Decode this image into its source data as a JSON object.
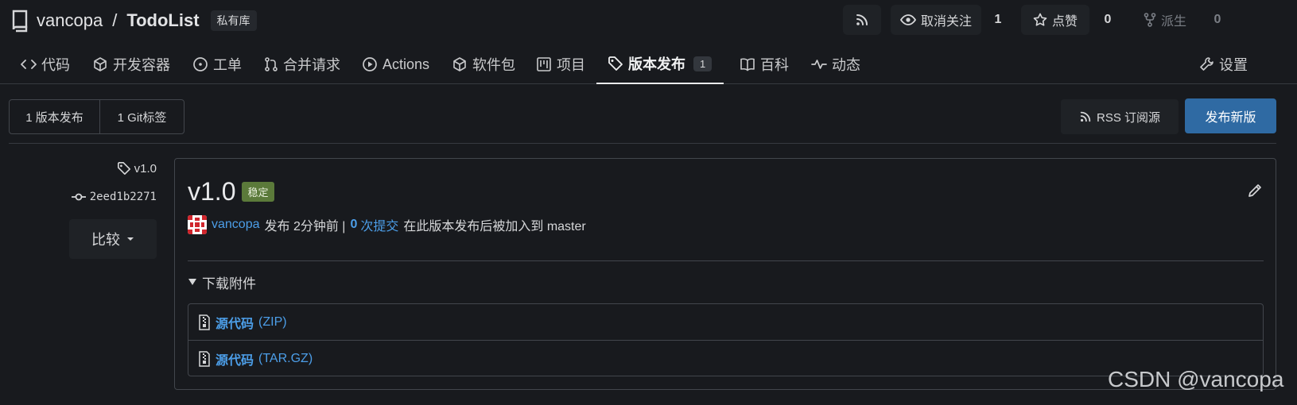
{
  "repo": {
    "owner": "vancopa",
    "separator": "/",
    "name": "TodoList",
    "visibility": "私有库",
    "icon": "repo-icon"
  },
  "header_actions": {
    "rss_icon": "rss-icon",
    "unwatch_label": "取消关注",
    "unwatch_count": "1",
    "star_label": "点赞",
    "star_count": "0",
    "fork_label": "派生",
    "fork_count": "0"
  },
  "tabs": [
    {
      "label": "代码",
      "icon": "code-icon"
    },
    {
      "label": "开发容器",
      "icon": "box-icon"
    },
    {
      "label": "工单",
      "icon": "issue-icon"
    },
    {
      "label": "合并请求",
      "icon": "pull-request-icon"
    },
    {
      "label": "Actions",
      "icon": "play-icon"
    },
    {
      "label": "软件包",
      "icon": "package-icon"
    },
    {
      "label": "项目",
      "icon": "project-icon"
    },
    {
      "label": "版本发布",
      "icon": "tag-icon",
      "count": "1",
      "active": true
    },
    {
      "label": "百科",
      "icon": "book-icon"
    },
    {
      "label": "动态",
      "icon": "pulse-icon"
    },
    {
      "label": "设置",
      "icon": "tools-icon"
    }
  ],
  "toolbar": {
    "releases_count": "1 版本发布",
    "tags_count": "1 Git标签",
    "rss_label": "RSS 订阅源",
    "new_release_label": "发布新版"
  },
  "release": {
    "tag": "v1.0",
    "commit": "2eed1b2271",
    "compare_label": "比较",
    "title": "v1.0",
    "stable_badge": "稳定",
    "author": "vancopa",
    "published": "发布 2分钟前 |",
    "commits_count": "0",
    "commits_link": "次提交",
    "commits_suffix": "在此版本发布后被加入到 master",
    "downloads_heading": "下载附件",
    "assets": [
      {
        "name": "源代码",
        "format": "(ZIP)"
      },
      {
        "name": "源代码",
        "format": "(TAR.GZ)"
      }
    ]
  },
  "watermark": "CSDN @vancopa",
  "colors": {
    "background": "#181a1e",
    "accent_blue": "#2f6aa3",
    "link": "#4c9ee8",
    "stable_badge": "#5b7a3a"
  }
}
